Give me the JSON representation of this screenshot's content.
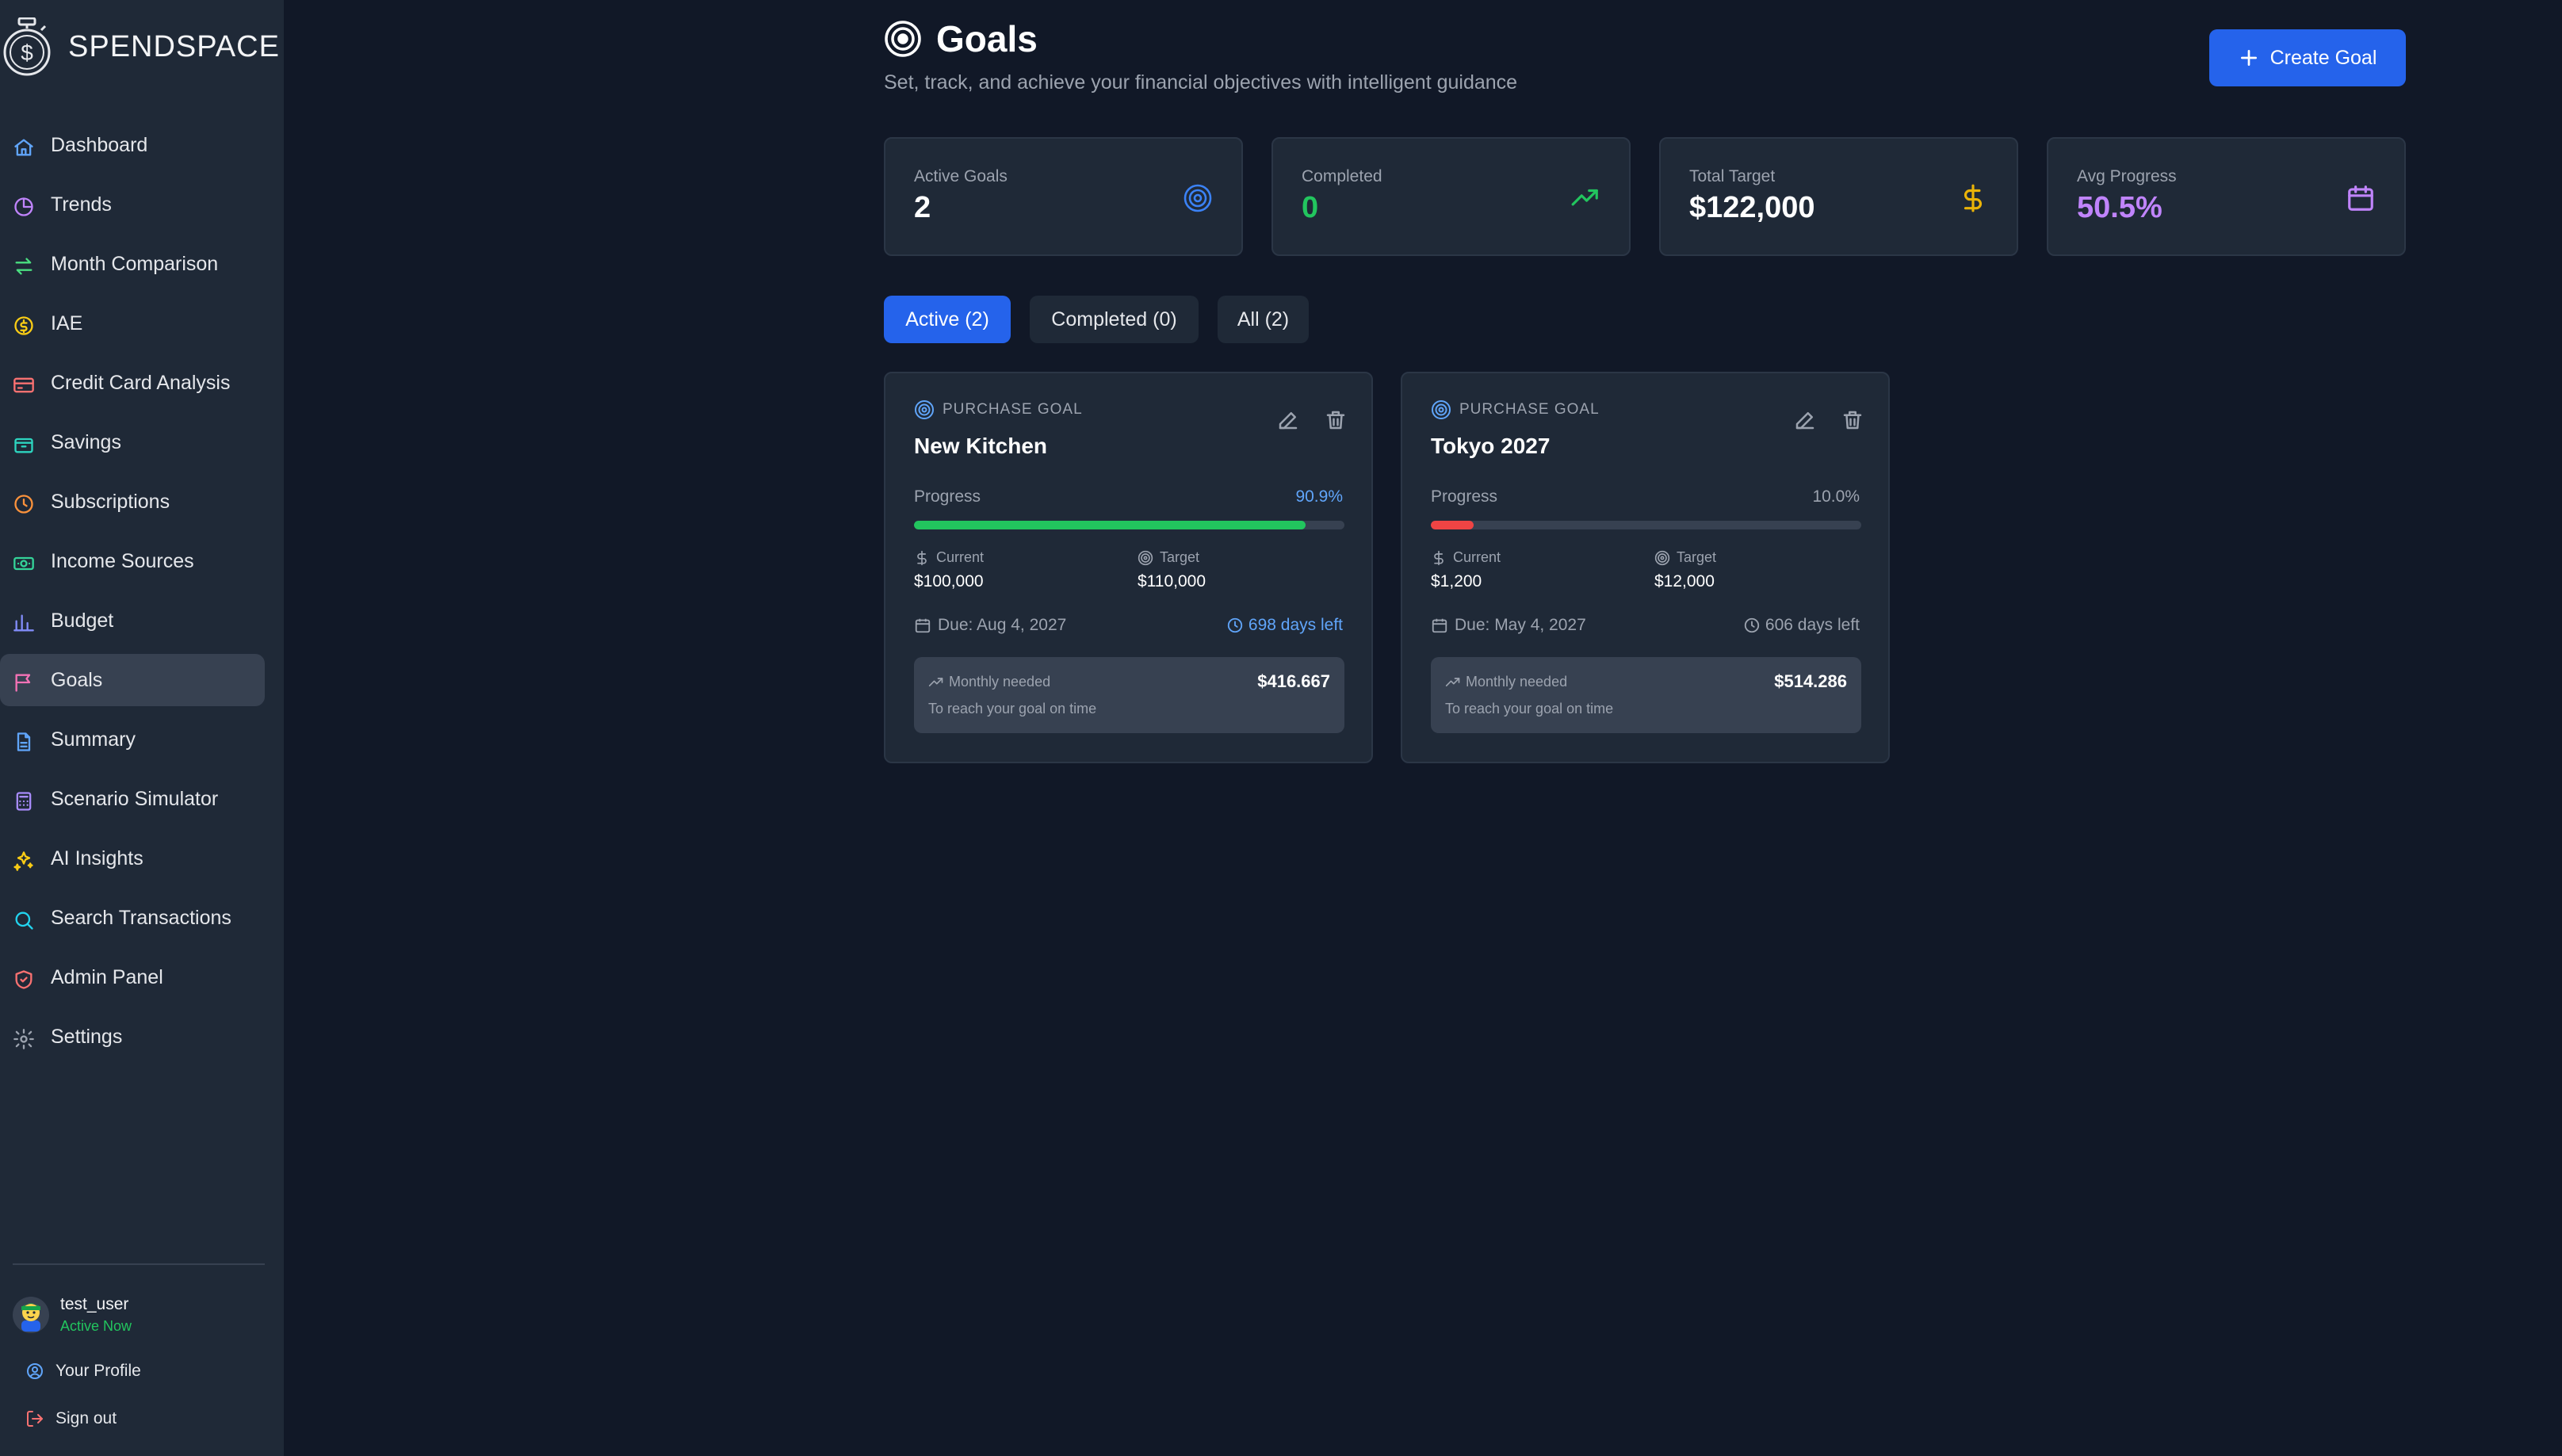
{
  "app": {
    "brand": "SPENDSPACE"
  },
  "sidebar": {
    "items": [
      {
        "label": "Dashboard",
        "icon": "home-icon",
        "color": "#60a5fa"
      },
      {
        "label": "Trends",
        "icon": "pie-chart-icon",
        "color": "#c084fc"
      },
      {
        "label": "Month Comparison",
        "icon": "swap-arrows-icon",
        "color": "#4ade80"
      },
      {
        "label": "IAE",
        "icon": "dollar-circle-icon",
        "color": "#facc15"
      },
      {
        "label": "Credit Card Analysis",
        "icon": "credit-card-icon",
        "color": "#f87171"
      },
      {
        "label": "Savings",
        "icon": "piggy-bank-icon",
        "color": "#2dd4bf"
      },
      {
        "label": "Subscriptions",
        "icon": "clock-icon",
        "color": "#fb923c"
      },
      {
        "label": "Income Sources",
        "icon": "banknote-icon",
        "color": "#34d399"
      },
      {
        "label": "Budget",
        "icon": "bar-chart-icon",
        "color": "#818cf8"
      },
      {
        "label": "Goals",
        "icon": "flag-icon",
        "color": "#f472b6",
        "active": true
      },
      {
        "label": "Summary",
        "icon": "document-icon",
        "color": "#60a5fa"
      },
      {
        "label": "Scenario Simulator",
        "icon": "calculator-icon",
        "color": "#a78bfa"
      },
      {
        "label": "AI Insights",
        "icon": "sparkles-icon",
        "color": "#facc15"
      },
      {
        "label": "Search Transactions",
        "icon": "search-icon",
        "color": "#22d3ee"
      },
      {
        "label": "Admin Panel",
        "icon": "shield-icon",
        "color": "#f87171"
      },
      {
        "label": "Settings",
        "icon": "gear-icon",
        "color": "#9ca3af"
      }
    ],
    "user": {
      "name": "test_user",
      "status": "Active Now"
    },
    "profile_label": "Your Profile",
    "signout_label": "Sign out"
  },
  "header": {
    "title": "Goals",
    "subtitle": "Set, track, and achieve your financial objectives with intelligent guidance",
    "create_label": "Create Goal"
  },
  "stats": [
    {
      "label": "Active Goals",
      "value": "2",
      "icon": "target-icon",
      "color": "#ffffff",
      "icon_color": "#3b82f6"
    },
    {
      "label": "Completed",
      "value": "0",
      "icon": "trending-up-icon",
      "color": "#22c55e",
      "icon_color": "#22c55e"
    },
    {
      "label": "Total Target",
      "value": "$122,000",
      "icon": "dollar-icon",
      "color": "#ffffff",
      "icon_color": "#eab308"
    },
    {
      "label": "Avg Progress",
      "value": "50.5%",
      "icon": "calendar-icon",
      "color": "#c084fc",
      "icon_color": "#c084fc"
    }
  ],
  "tabs": [
    {
      "label": "Active (2)",
      "active": true
    },
    {
      "label": "Completed (0)"
    },
    {
      "label": "All (2)"
    }
  ],
  "goals": [
    {
      "type": "PURCHASE GOAL",
      "title": "New Kitchen",
      "progress_label": "Progress",
      "progress_text": "90.9%",
      "progress": 0.909,
      "progress_color": "#60a5fa",
      "bar_color": "#22c55e",
      "current_label": "Current",
      "current": "$100,000",
      "target_label": "Target",
      "target": "$110,000",
      "due": "Due: Aug 4, 2027",
      "days_left": "698 days left",
      "days_color": "#60a5fa",
      "monthly_label": "Monthly needed",
      "monthly": "$416.667",
      "monthly_hint": "To reach your goal on time"
    },
    {
      "type": "PURCHASE GOAL",
      "title": "Tokyo 2027",
      "progress_label": "Progress",
      "progress_text": "10.0%",
      "progress": 0.1,
      "progress_color": "#9ca3af",
      "bar_color": "#ef4444",
      "current_label": "Current",
      "current": "$1,200",
      "target_label": "Target",
      "target": "$12,000",
      "due": "Due: May 4, 2027",
      "days_left": "606 days left",
      "days_color": "#9ca3af",
      "monthly_label": "Monthly needed",
      "monthly": "$514.286",
      "monthly_hint": "To reach your goal on time"
    }
  ]
}
